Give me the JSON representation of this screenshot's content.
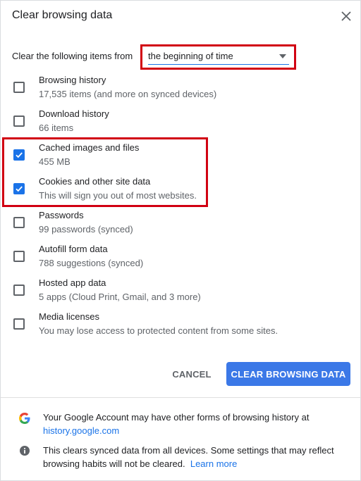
{
  "dialog": {
    "title": "Clear browsing data",
    "close_icon": "close-icon"
  },
  "time_range": {
    "label": "Clear the following items from",
    "selected": "the beginning of time"
  },
  "items": [
    {
      "label": "Browsing history",
      "detail": "17,535 items (and more on synced devices)",
      "checked": false
    },
    {
      "label": "Download history",
      "detail": "66 items",
      "checked": false
    },
    {
      "label": "Cached images and files",
      "detail": "455 MB",
      "checked": true
    },
    {
      "label": "Cookies and other site data",
      "detail": "This will sign you out of most websites.",
      "checked": true
    },
    {
      "label": "Passwords",
      "detail": "99 passwords (synced)",
      "checked": false
    },
    {
      "label": "Autofill form data",
      "detail": "788 suggestions (synced)",
      "checked": false
    },
    {
      "label": "Hosted app data",
      "detail": "5 apps (Cloud Print, Gmail, and 3 more)",
      "checked": false
    },
    {
      "label": "Media licenses",
      "detail": "You may lose access to protected content from some sites.",
      "checked": false
    }
  ],
  "actions": {
    "cancel_label": "CANCEL",
    "clear_label": "CLEAR BROWSING DATA"
  },
  "footer": {
    "google_text": "Your Google Account may have other forms of browsing history at",
    "google_link": "history.google.com",
    "info_text": "This clears synced data from all devices. Some settings that may reflect browsing habits will not be cleared.",
    "info_link": "Learn more"
  },
  "colors": {
    "accent": "#1a73e8",
    "button_blue": "#3b78e7",
    "highlight_red": "#d10012"
  },
  "icons": {
    "google": "google-g-icon",
    "info": "info-icon",
    "dropdown": "chevron-down-icon",
    "checkmark": "checkmark-icon"
  }
}
